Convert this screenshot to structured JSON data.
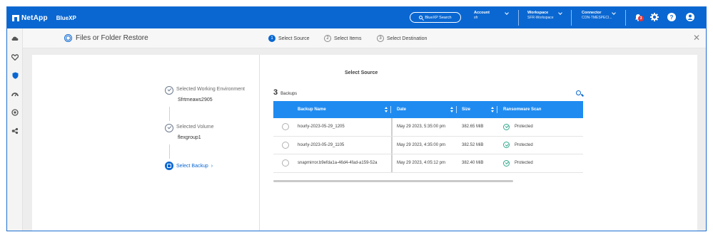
{
  "topbar": {
    "brand": "NetApp",
    "product": "BlueXP",
    "search_label": "BlueXP Search",
    "account": {
      "title": "Account",
      "value": "sfr"
    },
    "workspace": {
      "title": "Workspace",
      "value": "SFR-Workspace"
    },
    "connector": {
      "title": "Connector",
      "value": "CON-TMESPECI..."
    },
    "notification_count": "3"
  },
  "subheader": {
    "title": "Files or Folder Restore",
    "steps": [
      {
        "num": "1",
        "label": "Select Source",
        "active": true
      },
      {
        "num": "2",
        "label": "Select Items",
        "active": false
      },
      {
        "num": "3",
        "label": "Select Destination",
        "active": false
      }
    ]
  },
  "main": {
    "section_title": "Select Source",
    "progress": {
      "working_env_label": "Selected Working Environment",
      "working_env_value": "Sfrtmeaws2905",
      "volume_label": "Selected Volume",
      "volume_value": "flexgroup1",
      "current_label": "Select Backup",
      "current_chevron": "›"
    },
    "backups": {
      "count": "3",
      "count_label": "Backups",
      "columns": [
        "Backup Name",
        "Date",
        "Size",
        "Ransomware Scan"
      ],
      "rows": [
        {
          "name": "hourly-2023-05-29_1205",
          "date": "May 29 2023, 5:35:00 pm",
          "size": "382.65 MiB",
          "scan": "Protected"
        },
        {
          "name": "hourly-2023-05-29_1105",
          "date": "May 29 2023, 4:35:00 pm",
          "size": "382.52 MiB",
          "scan": "Protected"
        },
        {
          "name": "snapmirror.b9efda1a-46d4-4fad-a159-52a",
          "date": "May 29 2023, 4:05:12 pm",
          "size": "382.40 MiB",
          "scan": "Protected"
        }
      ]
    }
  },
  "colors": {
    "brand_blue": "#0a67d1",
    "table_header": "#1f8bf0",
    "protected_green": "#2ea88b",
    "badge_red": "#e0383e"
  }
}
